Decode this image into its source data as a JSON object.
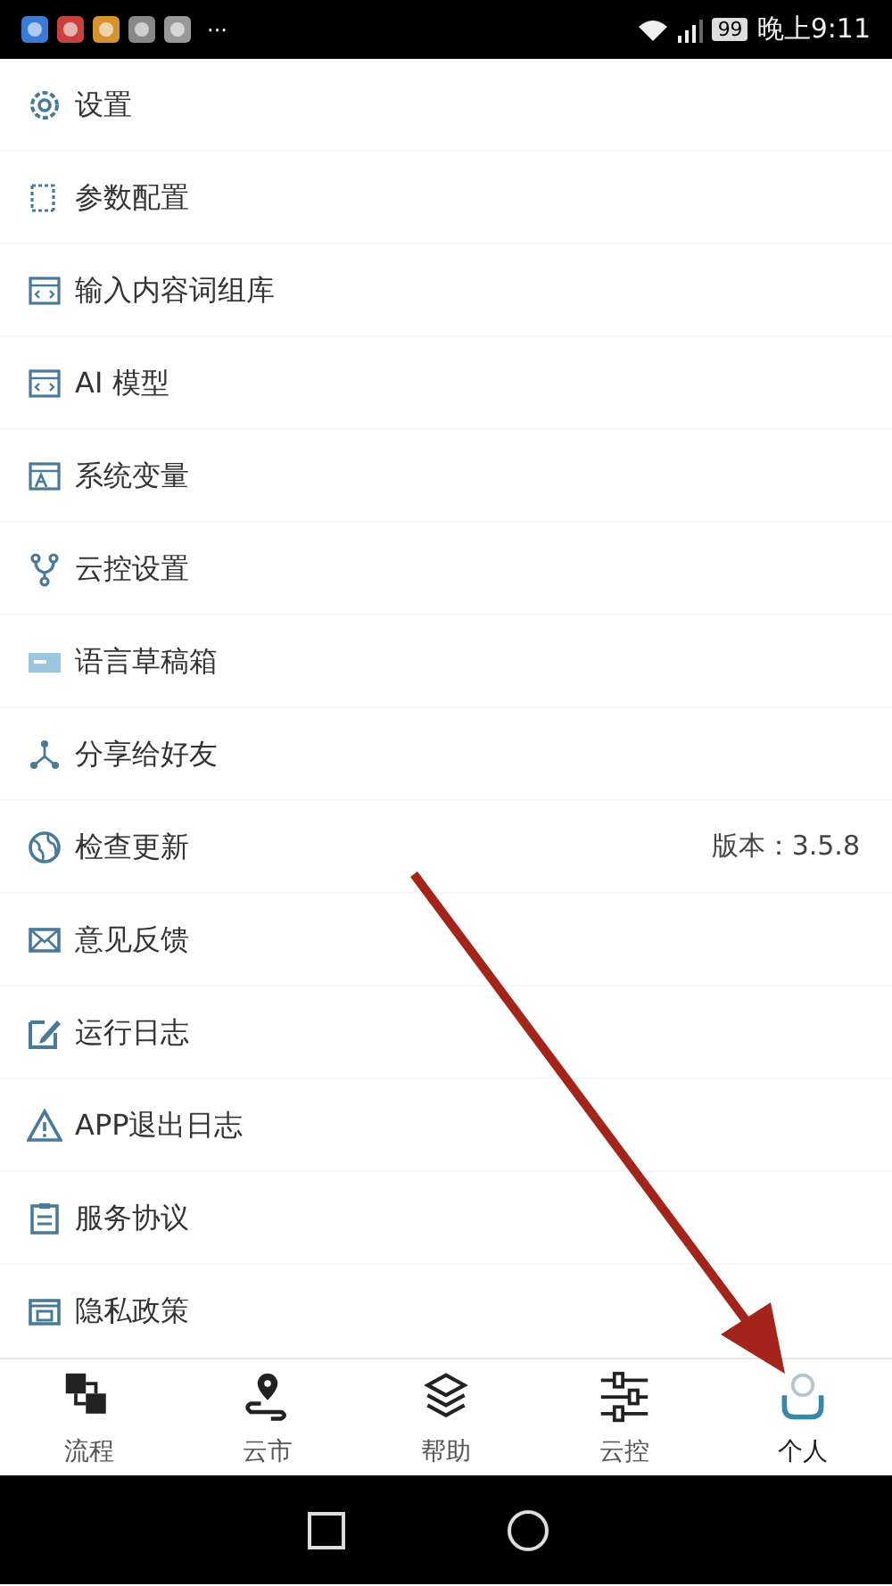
{
  "status_bar": {
    "battery": "99",
    "time": "晚上9:11",
    "overflow": "···"
  },
  "menu": [
    {
      "kind": "gear",
      "label": "设置"
    },
    {
      "kind": "frame",
      "label": "参数配置"
    },
    {
      "kind": "code",
      "label": "输入内容词组库"
    },
    {
      "kind": "code",
      "label": "AI 模型"
    },
    {
      "kind": "var",
      "label": "系统变量"
    },
    {
      "kind": "fork",
      "label": "云控设置"
    },
    {
      "kind": "draft",
      "label": "语言草稿箱"
    },
    {
      "kind": "share",
      "label": "分享给好友"
    },
    {
      "kind": "globe",
      "label": "检查更新",
      "value": "版本：3.5.8"
    },
    {
      "kind": "mail",
      "label": "意见反馈"
    },
    {
      "kind": "edit",
      "label": "运行日志"
    },
    {
      "kind": "warn",
      "label": "APP退出日志"
    },
    {
      "kind": "doc",
      "label": "服务协议"
    },
    {
      "kind": "privacy",
      "label": "隐私政策"
    }
  ],
  "tabs": [
    {
      "kind": "flow",
      "label": "流程",
      "selected": false
    },
    {
      "kind": "pin",
      "label": "云市",
      "selected": false
    },
    {
      "kind": "layers",
      "label": "帮助",
      "selected": false
    },
    {
      "kind": "sliders",
      "label": "云控",
      "selected": false
    },
    {
      "kind": "person",
      "label": "个人",
      "selected": true
    }
  ]
}
